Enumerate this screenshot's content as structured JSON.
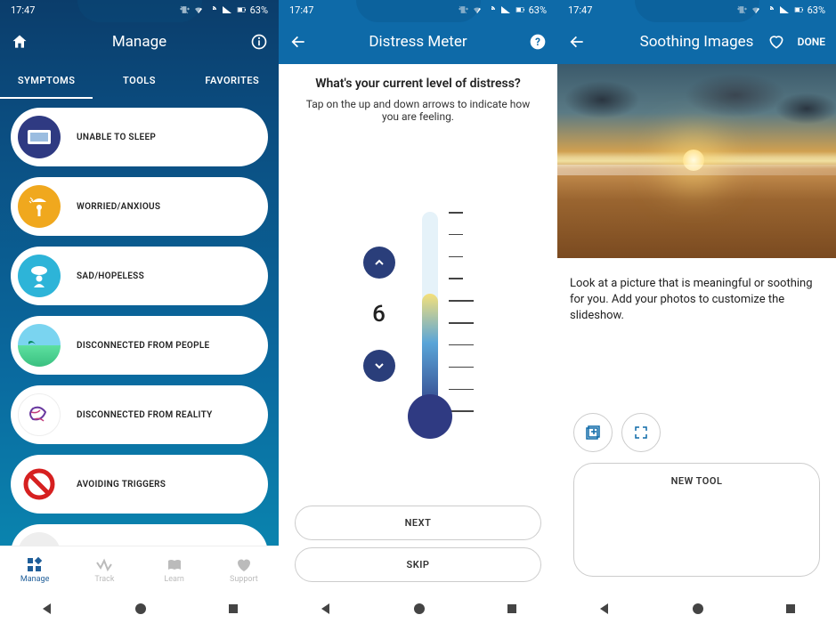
{
  "status": {
    "time": "17:47",
    "battery": "63%"
  },
  "screen1": {
    "title": "Manage",
    "tabs": [
      "SYMPTOMS",
      "TOOLS",
      "FAVORITES"
    ],
    "active_tab": 0,
    "symptoms": [
      {
        "label": "UNABLE TO SLEEP",
        "icon": "pillow",
        "color": "#2f3a82"
      },
      {
        "label": "WORRIED/ANXIOUS",
        "icon": "umbrella-person",
        "color": "#f0a81e"
      },
      {
        "label": "SAD/HOPELESS",
        "icon": "cloud-person",
        "color": "#2db4d8"
      },
      {
        "label": "DISCONNECTED FROM PEOPLE",
        "icon": "beach",
        "color": "#7fe0b8"
      },
      {
        "label": "DISCONNECTED FROM REALITY",
        "icon": "abstract",
        "color": "#ffffff"
      },
      {
        "label": "AVOIDING TRIGGERS",
        "icon": "no-symbol",
        "color": "#ffffff"
      }
    ],
    "bottomnav": [
      {
        "label": "Manage",
        "icon": "grid"
      },
      {
        "label": "Track",
        "icon": "wave"
      },
      {
        "label": "Learn",
        "icon": "book"
      },
      {
        "label": "Support",
        "icon": "heart"
      }
    ],
    "active_nav": 0
  },
  "screen2": {
    "title": "Distress Meter",
    "question": "What's your current level of distress?",
    "subtitle": "Tap on the up and down arrows to indicate how you are feeling.",
    "value": "6",
    "next_label": "NEXT",
    "skip_label": "SKIP"
  },
  "screen3": {
    "title": "Soothing Images",
    "done_label": "DONE",
    "description": "Look at a picture that is meaningful or soothing for you. Add your photos to customize the slideshow.",
    "new_tool_label": "NEW TOOL"
  }
}
